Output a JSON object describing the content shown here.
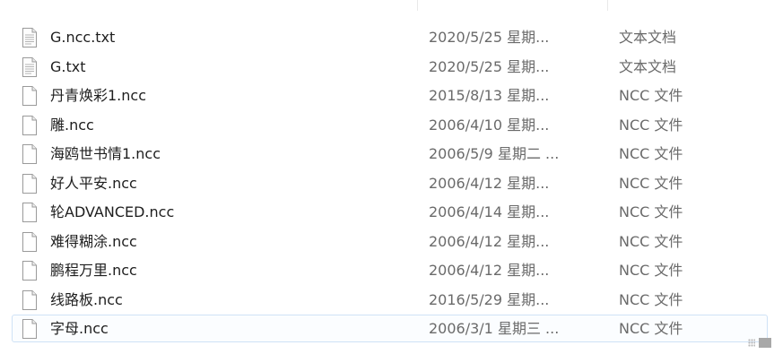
{
  "files": [
    {
      "name": "G.ncc.txt",
      "date": "2020/5/25 星期...",
      "type": "文本文档",
      "icon": "text-document-icon"
    },
    {
      "name": "G.txt",
      "date": "2020/5/25 星期...",
      "type": "文本文档",
      "icon": "text-document-icon"
    },
    {
      "name": "丹青焕彩1.ncc",
      "date": "2015/8/13 星期...",
      "type": "NCC 文件",
      "icon": "blank-file-icon"
    },
    {
      "name": "雕.ncc",
      "date": "2006/4/10 星期...",
      "type": "NCC 文件",
      "icon": "blank-file-icon"
    },
    {
      "name": "海鸥世书情1.ncc",
      "date": "2006/5/9 星期二 ...",
      "type": "NCC 文件",
      "icon": "blank-file-icon"
    },
    {
      "name": "好人平安.ncc",
      "date": "2006/4/12 星期...",
      "type": "NCC 文件",
      "icon": "blank-file-icon"
    },
    {
      "name": "轮ADVANCED.ncc",
      "date": "2006/4/14 星期...",
      "type": "NCC 文件",
      "icon": "blank-file-icon"
    },
    {
      "name": "难得糊涂.ncc",
      "date": "2006/4/12 星期...",
      "type": "NCC 文件",
      "icon": "blank-file-icon"
    },
    {
      "name": "鹏程万里.ncc",
      "date": "2006/4/12 星期...",
      "type": "NCC 文件",
      "icon": "blank-file-icon"
    },
    {
      "name": "线路板.ncc",
      "date": "2016/5/29 星期...",
      "type": "NCC 文件",
      "icon": "blank-file-icon"
    },
    {
      "name": "字母.ncc",
      "date": "2006/3/1 星期三 ...",
      "type": "NCC 文件",
      "icon": "blank-file-icon"
    }
  ],
  "selected_index": 10,
  "colors": {
    "name_text": "#1e1e1e",
    "meta_text": "#6a6a6a",
    "selection_border": "#cfe2f6"
  }
}
